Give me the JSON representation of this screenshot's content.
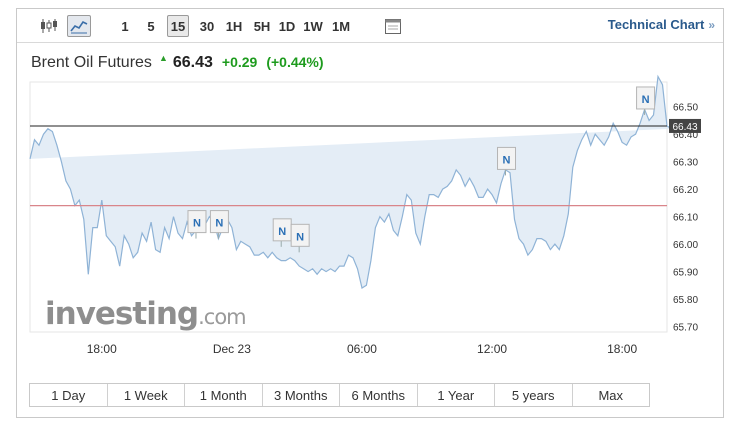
{
  "toolbar": {
    "chart_types": [
      {
        "name": "candlestick-chart-button",
        "icon": "candlestick-icon",
        "active": false
      },
      {
        "name": "area-chart-button",
        "icon": "area-chart-icon",
        "active": true
      }
    ],
    "intervals": [
      {
        "label": "1",
        "active": false
      },
      {
        "label": "5",
        "active": false
      },
      {
        "label": "15",
        "active": true
      },
      {
        "label": "30",
        "active": false
      },
      {
        "label": "1H",
        "active": false
      },
      {
        "label": "5H",
        "active": false
      },
      {
        "label": "1D",
        "active": false
      },
      {
        "label": "1W",
        "active": false
      },
      {
        "label": "1M",
        "active": false
      }
    ],
    "calendar_icon": "calendar-icon",
    "technical_chart_label": "Technical Chart",
    "technical_chart_chevron": "»"
  },
  "quote": {
    "name": "Brent Oil Futures",
    "direction_icon": "up-arrow-icon",
    "price": "66.43",
    "change": "+0.29",
    "change_pct": "(+0.44%)",
    "positive_color": "#1e9b1e"
  },
  "chart_data": {
    "type": "area",
    "x": [
      0,
      1,
      2,
      3,
      4,
      5,
      6,
      7,
      8,
      9,
      10,
      11,
      12,
      13,
      14,
      15,
      16,
      17,
      18,
      19,
      20,
      21,
      22,
      23,
      24,
      25,
      26,
      27,
      28,
      29,
      30,
      31,
      32,
      33,
      34,
      35,
      36,
      37,
      38,
      39,
      40,
      41,
      42,
      43,
      44,
      45,
      46,
      47,
      48,
      49,
      50,
      51,
      52,
      53,
      54,
      55,
      56,
      57,
      58,
      59,
      60,
      61,
      62,
      63,
      64,
      65,
      66,
      67,
      68,
      69,
      70,
      71,
      72,
      73,
      74,
      75,
      76,
      77,
      78,
      79,
      80,
      81,
      82,
      83,
      84,
      85,
      86,
      87,
      88,
      89,
      90,
      91,
      92,
      93,
      94,
      95,
      96,
      97,
      98,
      99,
      100,
      101,
      102,
      103,
      104,
      105,
      106,
      107,
      108,
      109,
      110,
      111,
      112,
      113,
      114,
      115,
      116,
      117,
      118,
      119,
      120,
      121,
      122,
      123,
      124,
      125,
      126,
      127,
      128,
      129,
      130,
      131,
      132,
      133,
      134,
      135,
      136,
      137,
      138,
      139,
      140,
      141,
      142,
      143,
      144,
      145,
      146,
      147,
      148,
      149,
      150,
      151,
      152,
      153,
      154,
      155,
      156,
      157,
      158,
      159,
      160
    ],
    "values": [
      66.31,
      66.38,
      66.36,
      66.4,
      66.42,
      66.41,
      66.36,
      66.3,
      66.23,
      66.2,
      66.14,
      66.16,
      66.09,
      65.89,
      66.06,
      66.06,
      66.16,
      66.03,
      66.01,
      65.99,
      65.92,
      66.03,
      66.0,
      65.95,
      65.97,
      66.04,
      66.01,
      66.08,
      65.98,
      65.97,
      66.06,
      66.02,
      66.1,
      66.04,
      66.02,
      66.08,
      66.03,
      66.05,
      66.09,
      66.07,
      66.1,
      66.08,
      66.02,
      66.06,
      66.09,
      66.06,
      65.98,
      66.01,
      66.0,
      65.99,
      65.96,
      65.96,
      65.97,
      65.95,
      65.97,
      65.95,
      65.94,
      65.94,
      65.95,
      65.94,
      65.92,
      65.91,
      65.9,
      65.91,
      65.89,
      65.91,
      65.9,
      65.91,
      65.9,
      65.92,
      65.92,
      65.96,
      65.95,
      65.91,
      65.84,
      65.85,
      65.94,
      66.06,
      66.1,
      66.08,
      66.11,
      66.05,
      66.03,
      66.1,
      66.18,
      66.16,
      66.04,
      66.0,
      66.1,
      66.18,
      66.18,
      66.17,
      66.2,
      66.21,
      66.23,
      66.27,
      66.25,
      66.21,
      66.24,
      66.21,
      66.17,
      66.17,
      66.2,
      66.18,
      66.15,
      66.22,
      66.27,
      66.26,
      66.09,
      66.02,
      66.0,
      65.96,
      65.98,
      66.02,
      66.02,
      66.01,
      65.98,
      66.0,
      65.98,
      66.03,
      66.11,
      66.28,
      66.34,
      66.38,
      66.41,
      66.36,
      66.4,
      66.38,
      66.36,
      66.39,
      66.44,
      66.41,
      66.37,
      66.36,
      66.39,
      66.4,
      66.44,
      66.49,
      66.45,
      66.47,
      66.61,
      66.58,
      66.43,
      66.42
    ],
    "x_tick_labels": [
      {
        "x": 16,
        "label": "18:00"
      },
      {
        "x": 45,
        "label": "Dec 23"
      },
      {
        "x": 74,
        "label": "06:00"
      },
      {
        "x": 103,
        "label": "12:00"
      },
      {
        "x": 132,
        "label": "18:00"
      }
    ],
    "y_ticks": [
      65.7,
      65.8,
      65.9,
      66.0,
      66.1,
      66.2,
      66.3,
      66.4,
      66.5
    ],
    "y_tick_labels": [
      "65.70",
      "65.80",
      "65.90",
      "66.00",
      "66.10",
      "66.20",
      "66.30",
      "66.40",
      "66.50"
    ],
    "ylim": [
      65.68,
      66.59
    ],
    "xlim": [
      0,
      142
    ],
    "current_price": 66.43,
    "current_price_label": "66.43",
    "previous_close": 66.14,
    "news_markers": [
      {
        "x": 37,
        "y": 66.02,
        "label": "N"
      },
      {
        "x": 42,
        "y": 66.02,
        "label": "N"
      },
      {
        "x": 56,
        "y": 65.99,
        "label": "N"
      },
      {
        "x": 60,
        "y": 65.97,
        "label": "N"
      },
      {
        "x": 106,
        "y": 66.25,
        "label": "N"
      },
      {
        "x": 137,
        "y": 66.47,
        "label": "N"
      }
    ],
    "watermark_brand": "investing",
    "watermark_domain": ".com",
    "grid": false,
    "colors": {
      "line": "#8fb3d6",
      "fill": "#e4edf6",
      "current_line": "#222222",
      "previous_close_line": "#d9858a",
      "price_tag_bg": "#444444"
    }
  },
  "ranges": [
    "1 Day",
    "1 Week",
    "1 Month",
    "3 Months",
    "6 Months",
    "1 Year",
    "5 years",
    "Max"
  ]
}
